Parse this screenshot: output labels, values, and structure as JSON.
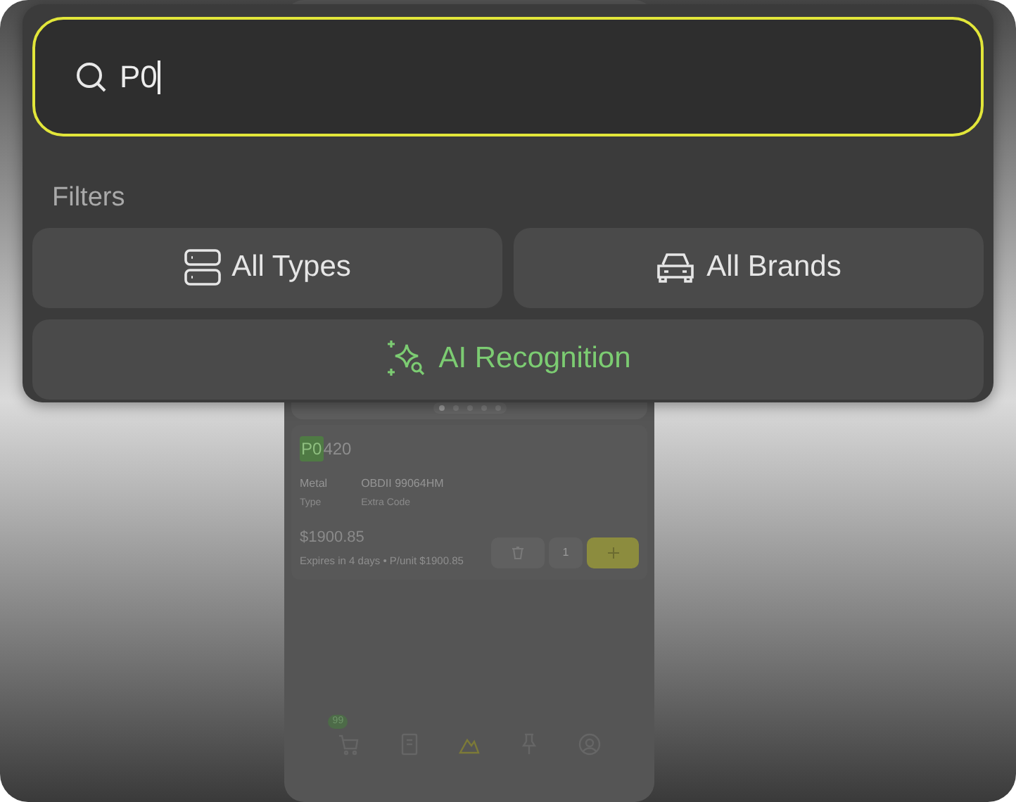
{
  "search": {
    "value": "P0",
    "focused": true
  },
  "filters_label": "Filters",
  "filters": [
    {
      "kind": "types",
      "label": "All Types"
    },
    {
      "kind": "brands",
      "label": "All Brands"
    },
    {
      "kind": "ai",
      "label": "AI Recognition"
    }
  ],
  "product": {
    "code_match": "P0",
    "code_rest": "420",
    "specs": [
      {
        "value": "Metal",
        "label": "Type"
      },
      {
        "value": "OBDII 99064HM",
        "label": "Extra Code"
      }
    ],
    "price": "$1900.85",
    "expiry": "Expires in 4 days • P/unit $1900.85",
    "quantity": "1"
  },
  "carousel_dots": [
    {
      "selected": true
    },
    {
      "selected": false
    },
    {
      "selected": false
    },
    {
      "selected": false
    },
    {
      "selected": false
    }
  ],
  "nav": [
    {
      "kind": "cart",
      "badge": "99",
      "selected": false
    },
    {
      "kind": "document",
      "selected": false
    },
    {
      "kind": "parts",
      "selected": true
    },
    {
      "kind": "pin",
      "selected": false
    },
    {
      "kind": "profile",
      "selected": false
    }
  ]
}
